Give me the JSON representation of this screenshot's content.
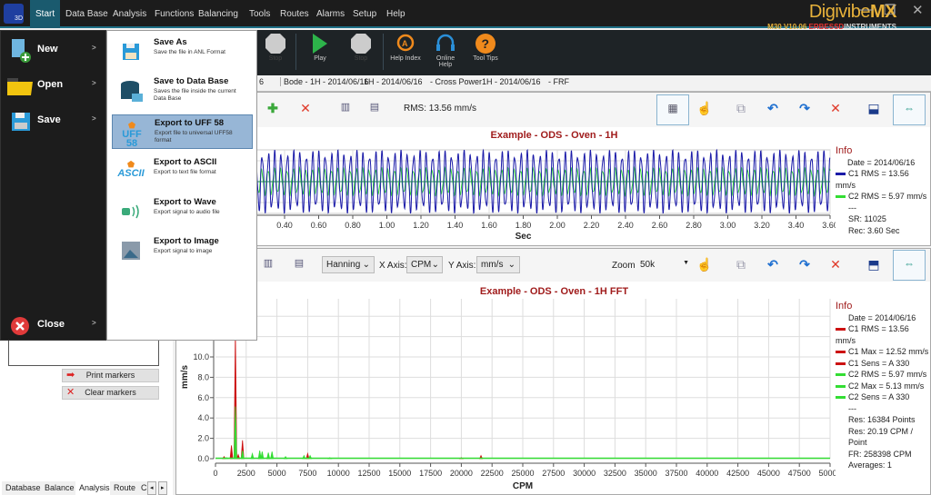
{
  "app": {
    "brand": "Digivibe",
    "brand_bold": "MX",
    "version": "M30 V10.06",
    "company_a": "ERBESSD",
    "company_b": "INSTRUMENTS",
    "logo_text": "3D"
  },
  "menubar": [
    "Start",
    "Data Base",
    "Analysis",
    "Functions",
    "Balancing",
    "Tools",
    "Routes",
    "Alarms",
    "Setup",
    "Help"
  ],
  "toolbar": {
    "stop_hidden": "Stop",
    "play": "Play",
    "stop": "Stop",
    "help_index": "Help Index",
    "online_help": "Online Help",
    "tool_tips": "Tool Tips"
  },
  "tabs": [
    "6",
    "Bode - 1H - 2014/06/16",
    "1H - 2014/06/16",
    "- Cross Power",
    "1H - 2014/06/16",
    "- FRF"
  ],
  "start_menu": {
    "left": [
      {
        "label": "New",
        "icon": "new-file-icon"
      },
      {
        "label": "Open",
        "icon": "folder-icon"
      },
      {
        "label": "Save",
        "icon": "floppy-icon"
      },
      {
        "label": "Close",
        "icon": "close-circle-icon"
      }
    ],
    "arrow": ">",
    "right": [
      {
        "label": "Save As",
        "desc": "Save the file in ANL Format",
        "icon": "floppy-icon"
      },
      {
        "label": "Save to Data Base",
        "desc": "Saves the file inside the current Data Base",
        "icon": "database-icon"
      },
      {
        "label": "Export to UFF 58",
        "desc": "Export file to universal UFF58 format",
        "icon": "uff58-icon",
        "icon_text": "UFF 58",
        "highlighted": true
      },
      {
        "label": "Export to ASCII",
        "desc": "Export to text file format",
        "icon": "ascii-icon",
        "icon_text": "ASCII"
      },
      {
        "label": "Export to Wave",
        "desc": "Export signal to audio file",
        "icon": "wave-icon"
      },
      {
        "label": "Export to Image",
        "desc": "Export signal to image",
        "icon": "image-icon"
      }
    ]
  },
  "top_panel": {
    "rms": "RMS: 13.56 mm/s"
  },
  "bottom_panel": {
    "window": "Hanning",
    "xaxis_label": "X Axis:",
    "xaxis": "CPM",
    "yaxis_label": "Y Axis:",
    "yaxis": "mm/s",
    "zoom_label": "Zoom",
    "zoom": "50k"
  },
  "left_panel": {
    "print": "Print markers",
    "clear": "Clear markers",
    "tabs": [
      "Database",
      "Balance",
      "Analysis",
      "Route",
      "C"
    ]
  },
  "colors": {
    "c1_time": "#1a1aa8",
    "c2": "#33dd33",
    "c1_fft": "#cc1111",
    "title": "#a01c1c",
    "accent": "#1d6f86"
  },
  "chart_data": [
    {
      "type": "line",
      "title": "Example - ODS - Oven - 1H",
      "xlabel": "Sec",
      "xlim": [
        0,
        3.6
      ],
      "xticks": [
        "0.40",
        "0.60",
        "0.80",
        "1.00",
        "1.20",
        "1.40",
        "1.60",
        "1.80",
        "2.00",
        "2.20",
        "2.40",
        "2.60",
        "2.80",
        "3.00",
        "3.20",
        "3.40",
        "3.60"
      ],
      "series": [
        {
          "name": "C1 RMS = 13.56 mm/s",
          "color": "#1a1aa8",
          "rms": 13.56,
          "freq_cpm": 1620
        },
        {
          "name": "C2 RMS = 5.97 mm/s",
          "color": "#33dd33",
          "rms": 5.97,
          "freq_cpm": 1620
        }
      ],
      "info": {
        "title": "Info",
        "lines": [
          "Date = 2014/06/16",
          "---",
          "SR: 11025",
          "Rec: 3.60 Sec"
        ]
      },
      "grid": true,
      "legend": "right"
    },
    {
      "type": "line",
      "title": "Example - ODS - Oven - 1H FFT",
      "xlabel": "CPM",
      "ylabel": "mm/s",
      "xlim": [
        0,
        50000
      ],
      "ylim": [
        0,
        15
      ],
      "xticks": [
        "0",
        "2500",
        "5000",
        "7500",
        "10000",
        "12500",
        "15000",
        "17500",
        "20000",
        "22500",
        "25000",
        "27500",
        "30000",
        "32500",
        "35000",
        "37500",
        "40000",
        "42500",
        "45000",
        "47500",
        "50000"
      ],
      "yticks": [
        "0.0",
        "2.0",
        "4.0",
        "6.0",
        "8.0",
        "10.0"
      ],
      "series": [
        {
          "name": "C1",
          "color": "#cc1111",
          "peaks": [
            [
              700,
              0.2
            ],
            [
              1300,
              1.3
            ],
            [
              1620,
              12.52
            ],
            [
              1850,
              0.4
            ],
            [
              2200,
              1.8
            ],
            [
              3600,
              0.4
            ],
            [
              4300,
              0.3
            ],
            [
              7500,
              0.5
            ],
            [
              20000,
              0.1
            ],
            [
              21600,
              0.3
            ]
          ]
        },
        {
          "name": "C2",
          "color": "#33dd33",
          "peaks": [
            [
              900,
              0.1
            ],
            [
              1620,
              5.13
            ],
            [
              2200,
              0.8
            ],
            [
              3000,
              0.5
            ],
            [
              3600,
              0.8
            ],
            [
              3800,
              0.7
            ],
            [
              4300,
              0.6
            ],
            [
              4600,
              0.7
            ],
            [
              5700,
              0.2
            ],
            [
              7200,
              0.3
            ],
            [
              7700,
              0.3
            ],
            [
              9300,
              0.1
            ]
          ]
        }
      ],
      "info": {
        "title": "Info",
        "lines": [
          "Date = 2014/06/16",
          "C1 RMS = 13.56 mm/s",
          "C1 Max = 12.52 mm/s",
          "C1 Sens = A 330",
          "C2 RMS = 5.97 mm/s",
          "C2 Max = 5.13 mm/s",
          "C2 Sens = A 330",
          "---",
          "Res: 16384 Points",
          "Res: 20.19 CPM / Point",
          "FR: 258398 CPM",
          "Averages: 1"
        ]
      },
      "grid": true,
      "legend": "right"
    }
  ]
}
